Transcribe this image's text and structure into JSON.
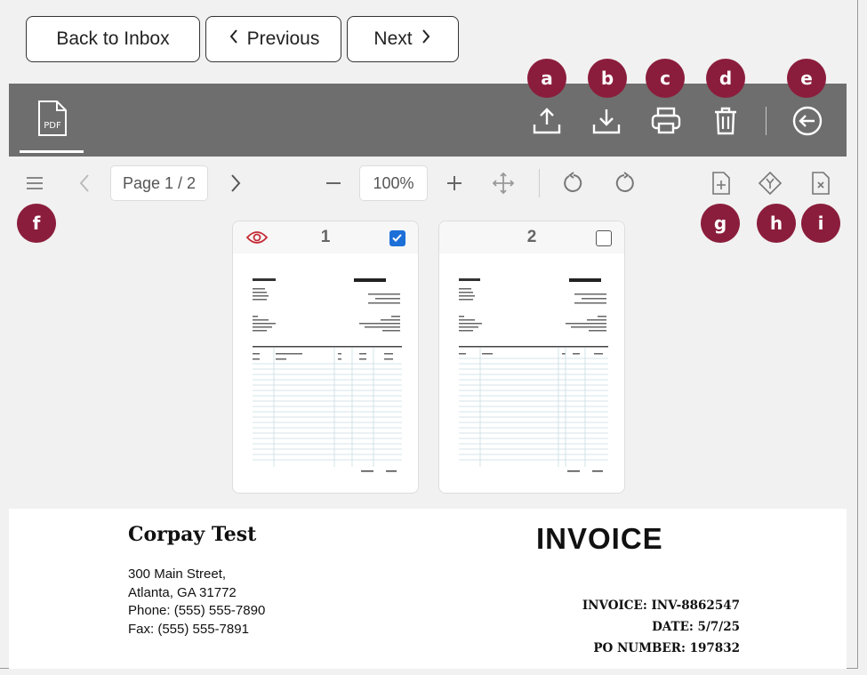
{
  "nav": {
    "back": "Back to Inbox",
    "previous": "Previous",
    "next": "Next"
  },
  "badges": [
    "a",
    "b",
    "c",
    "d",
    "e",
    "f",
    "g",
    "h",
    "i"
  ],
  "toolbar": {
    "pdf_tab": "PDF",
    "icons": [
      "upload-icon",
      "download-icon",
      "print-icon",
      "trash-icon",
      "back-circle-icon"
    ]
  },
  "viewer": {
    "page_indicator": "Page 1 / 2",
    "zoom": "100%",
    "icons": [
      "menu-icon",
      "chevron-left-icon",
      "chevron-right-icon",
      "zoom-out-icon",
      "zoom-in-icon",
      "fit-icon",
      "rotate-left-icon",
      "rotate-right-icon",
      "add-page-icon",
      "merge-icon",
      "delete-page-icon"
    ]
  },
  "thumbnails": [
    {
      "number": "1",
      "checked": true,
      "viewing": true
    },
    {
      "number": "2",
      "checked": false,
      "viewing": false
    }
  ],
  "document": {
    "company": "Corpay Test",
    "title": "INVOICE",
    "address": [
      "300 Main Street,",
      "Atlanta, GA 31772",
      "Phone: (555) 555-7890",
      "Fax: (555) 555-7891"
    ],
    "invoice_label": "INVOICE: INV-8862547",
    "date_label": "DATE: 5/7/25",
    "po_label": "PO NUMBER: 197832"
  },
  "colors": {
    "badge": "#8b1d3c",
    "toolbar": "#6e6e6e",
    "accent": "#1d6fd8"
  }
}
